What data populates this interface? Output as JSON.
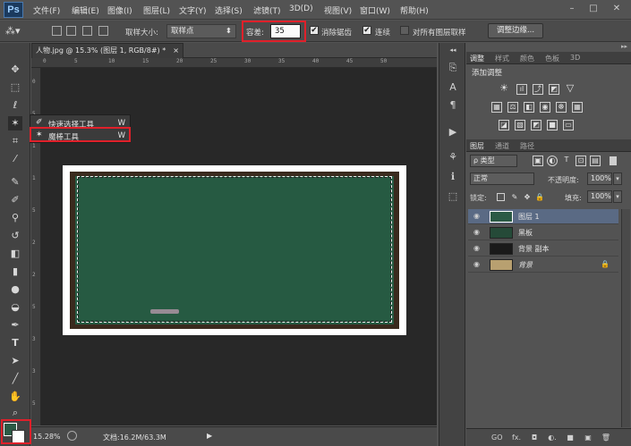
{
  "app": {
    "logo": "Ps"
  },
  "menu": [
    "文件(F)",
    "编辑(E)",
    "图像(I)",
    "图层(L)",
    "文字(Y)",
    "选择(S)",
    "滤镜(T)",
    "3D(D)",
    "视图(V)",
    "窗口(W)",
    "帮助(H)"
  ],
  "window_controls": [
    "–",
    "□",
    "✕"
  ],
  "options": {
    "sample_size_label": "取样大小:",
    "sample_size_value": "取样点",
    "tolerance_label": "容差:",
    "tolerance_value": "35",
    "antialias_label": "消除锯齿",
    "contiguous_label": "连续",
    "all_layers_label": "对所有图层取样",
    "refine_edge_label": "调整边缘..."
  },
  "flyout": {
    "items": [
      {
        "label": "快速选择工具",
        "key": "W"
      },
      {
        "label": "魔棒工具",
        "key": "W"
      }
    ]
  },
  "document": {
    "tab_title": "人物.jpg @ 15.3% (图层 1, RGB/8#) *",
    "close": "×"
  },
  "ruler_top_labels": [
    "0",
    "5",
    "10",
    "15",
    "20",
    "25",
    "30",
    "35",
    "40",
    "45",
    "50"
  ],
  "ruler_left_labels": [
    "0",
    "5",
    "1",
    "1",
    "5",
    "2",
    "2",
    "5",
    "3",
    "3",
    "5"
  ],
  "status": {
    "zoom": "15.28%",
    "doc_size": "文档:16.2M/63.3M"
  },
  "panels": {
    "top_tabs": [
      "调整",
      "样式",
      "颜色",
      "色板",
      "3D"
    ],
    "add_adjustment_label": "添加调整",
    "layers_tabs": [
      "图层",
      "通道",
      "路径"
    ],
    "filter_kind": "ρ 类型",
    "blend_mode": "正常",
    "opacity_label": "不透明度:",
    "opacity_value": "100%",
    "lock_label": "锁定:",
    "fill_label": "填充:",
    "fill_value": "100%",
    "layers": [
      {
        "name": "图层 1",
        "selected": true,
        "locked": false
      },
      {
        "name": "黑板",
        "selected": false,
        "locked": false
      },
      {
        "name": "背景 副本",
        "selected": false,
        "locked": false
      },
      {
        "name": "背景",
        "selected": false,
        "locked": true
      }
    ],
    "footer_icons": [
      "GO",
      "fx.",
      "◘",
      "◐.",
      "■",
      "▣",
      "🗑"
    ]
  },
  "colors": {
    "accent_highlight": "#e0202a",
    "foreground": "#2b5a45",
    "background": "#ffffff",
    "board_green": "#265a42",
    "frame_brown": "#3a2a1e"
  }
}
